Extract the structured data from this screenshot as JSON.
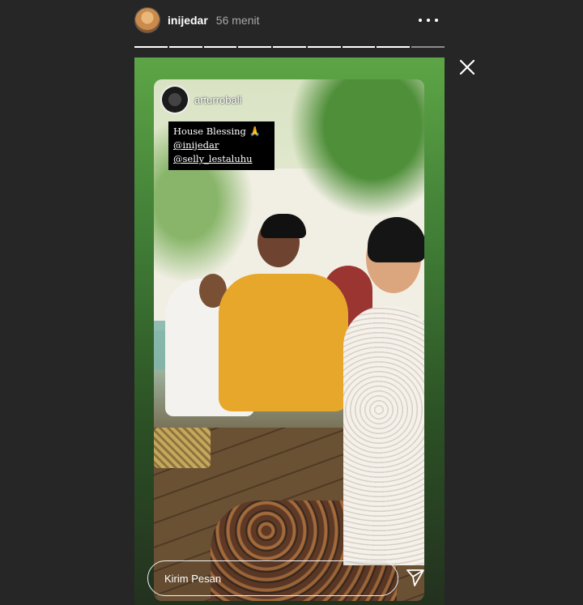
{
  "header": {
    "username": "inijedar",
    "time": "56 menit"
  },
  "progress": {
    "segments_total": 9,
    "current_segment": 8
  },
  "repost": {
    "username": "arturrobali",
    "caption_title": "House Blessing 🙏",
    "mentions": [
      "@inijedar",
      "@selly_lestaluhu"
    ]
  },
  "reply": {
    "placeholder": "Kirim Pesan"
  },
  "icons": {
    "more": "more-options-icon",
    "close": "close-icon",
    "send": "send-icon"
  },
  "colors": {
    "background": "#262626",
    "story_gradient_top": "#5da546"
  }
}
